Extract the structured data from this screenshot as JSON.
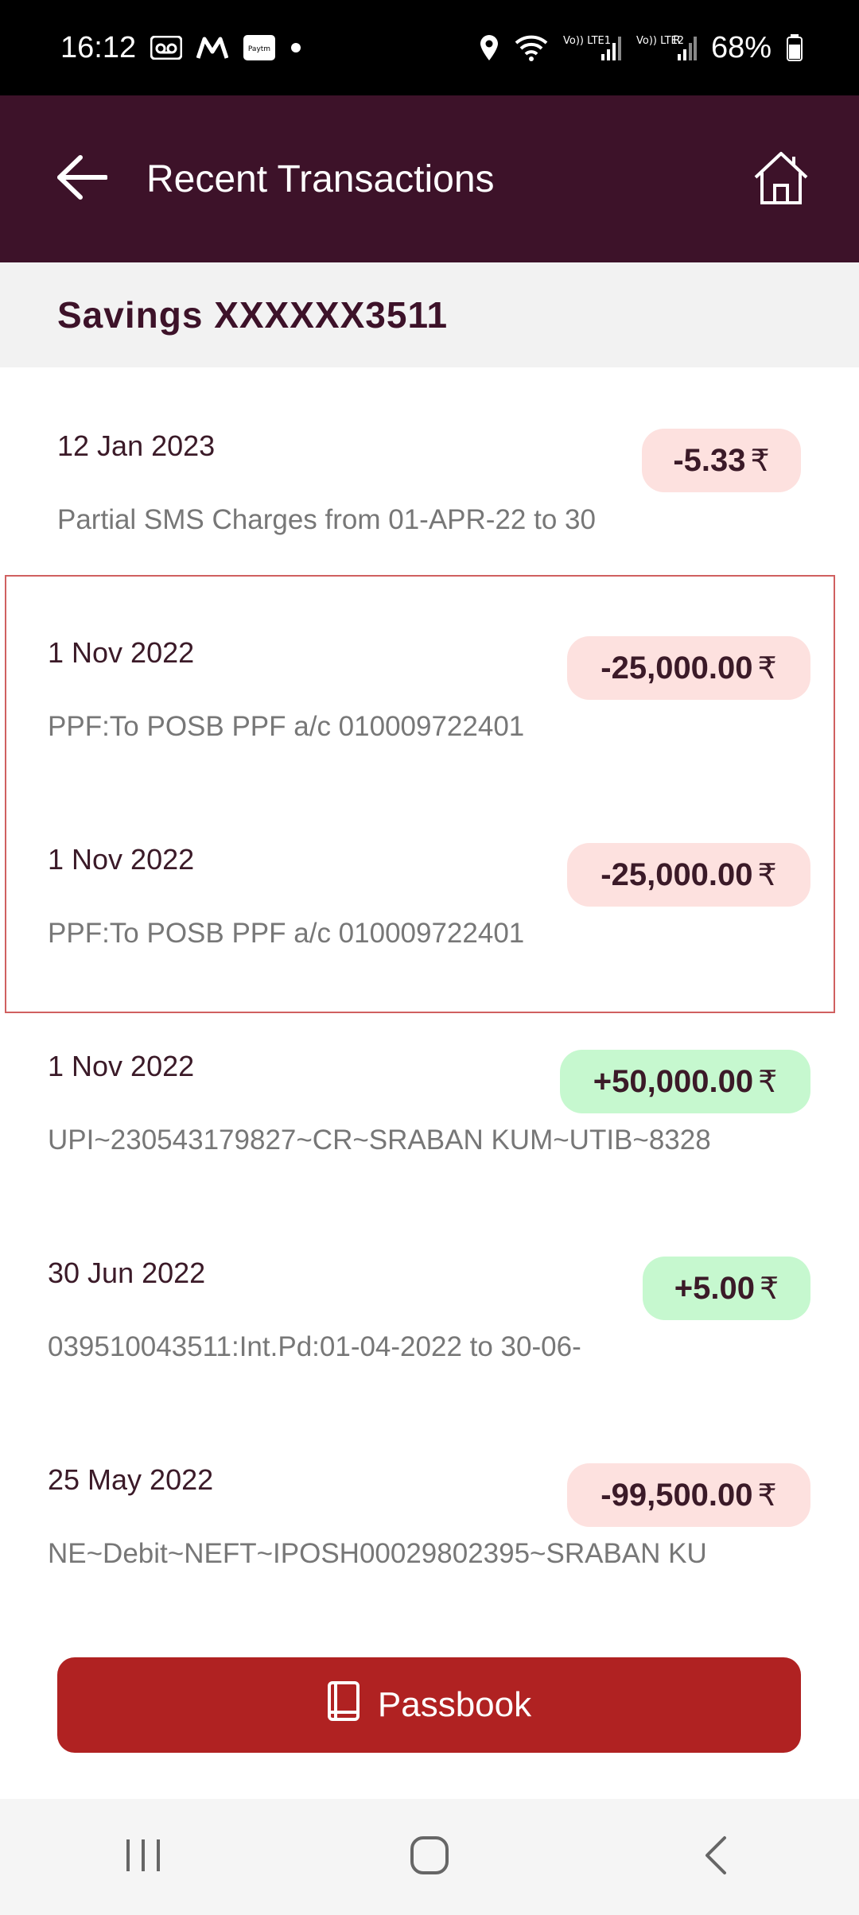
{
  "status_bar": {
    "time": "16:12",
    "battery": "68%",
    "icons": [
      "voicemail-icon",
      "myntra-icon",
      "paytm-icon",
      "dot-icon",
      "location-icon",
      "wifi-icon",
      "signal-lte1-icon",
      "signal-lte2-icon",
      "battery-icon"
    ],
    "carrier1": "Vo)) LTE1",
    "carrier2": "Vo)) LTE2",
    "paytm_label": "Paytm",
    "roaming_label": "R"
  },
  "app_bar": {
    "title": "Recent Transactions",
    "back_icon": "arrow-left-icon",
    "home_icon": "home-icon"
  },
  "account": {
    "title": "Savings XXXXXX3511"
  },
  "transactions": [
    {
      "date": "12 Jan 2023",
      "description": "Partial SMS Charges from 01-APR-22 to 30",
      "amount": "-5.33",
      "type": "debit"
    },
    {
      "date": "1 Nov 2022",
      "description": "PPF:To POSB PPF a/c 010009722401",
      "amount": "-25,000.00",
      "type": "debit"
    },
    {
      "date": "1 Nov 2022",
      "description": "PPF:To POSB PPF a/c 010009722401",
      "amount": "-25,000.00",
      "type": "debit"
    },
    {
      "date": "1 Nov 2022",
      "description": "UPI~230543179827~CR~SRABAN KUM~UTIB~8328",
      "amount": "+50,000.00",
      "type": "credit"
    },
    {
      "date": "30 Jun 2022",
      "description": "039510043511:Int.Pd:01-04-2022 to 30-06-",
      "amount": "+5.00",
      "type": "credit"
    },
    {
      "date": "25 May 2022",
      "description": "NE~Debit~NEFT~IPOSH00029802395~SRABAN KU",
      "amount": "-99,500.00",
      "type": "debit"
    }
  ],
  "currency_symbol": "₹",
  "passbook": {
    "label": "Passbook",
    "icon": "book-icon"
  },
  "nav": {
    "recents_icon": "recents-icon",
    "home_icon": "home-circle-icon",
    "back_icon": "back-chevron-icon"
  },
  "colors": {
    "app_bar": "#3d1229",
    "debit_bg": "#fde1df",
    "credit_bg": "#c6f8cf",
    "passbook_bg": "#b02222"
  }
}
